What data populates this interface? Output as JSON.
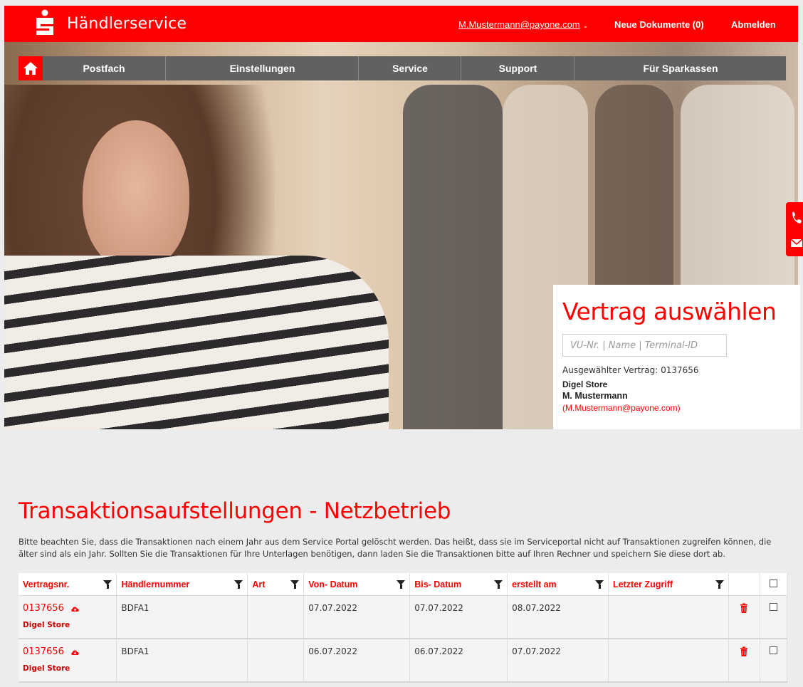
{
  "header": {
    "brand": "Händlerservice",
    "user_email": "M.Mustermann@payone.com",
    "documents_label": "Neue Dokumente (0)",
    "logout_label": "Abmelden"
  },
  "nav": {
    "home_icon": "home-icon",
    "items": [
      {
        "label": "Postfach"
      },
      {
        "label": "Einstellungen"
      },
      {
        "label": "Service"
      },
      {
        "label": "Support"
      },
      {
        "label": "Für Sparkassen"
      }
    ]
  },
  "contract": {
    "title": "Vertrag auswählen",
    "search_placeholder": "VU-Nr. | Name | Terminal-ID",
    "selected_label": "Ausgewählter Vertrag: 0137656",
    "store": "Digel Store",
    "person": "M. Mustermann",
    "email": "(M.Mustermann@payone.com)"
  },
  "page": {
    "title": "Transaktionsaufstellungen - Netzbetrieb",
    "notice": "Bitte beachten Sie, dass die Transaktionen nach einem Jahr aus dem Service Portal gelöscht werden. Das heißt, dass sie im Serviceportal nicht auf Transaktionen zugreifen können, die älter sind als ein Jahr. Sollten Sie die Transaktionen für Ihre Unterlagen benötigen, dann laden Sie die Transaktionen bitte auf Ihren Rechner und speichern Sie diese dort ab."
  },
  "table": {
    "columns": [
      "Vertragsnr.",
      "Händlernummer",
      "Art",
      "Von- Datum",
      "Bis- Datum",
      "erstellt am",
      "Letzter Zugriff"
    ],
    "rows": [
      {
        "vertragsnr": "0137656",
        "store": "Digel Store",
        "haendlernummer": "BDFA1",
        "art": "",
        "von": "07.07.2022",
        "bis": "07.07.2022",
        "erstellt": "08.07.2022",
        "zugriff": ""
      },
      {
        "vertragsnr": "0137656",
        "store": "Digel Store",
        "haendlernummer": "BDFA1",
        "art": "",
        "von": "06.07.2022",
        "bis": "06.07.2022",
        "erstellt": "07.07.2022",
        "zugriff": ""
      }
    ]
  },
  "colors": {
    "brand_red": "#ff0000",
    "nav_gray": "#616161",
    "background": "#ececec"
  }
}
